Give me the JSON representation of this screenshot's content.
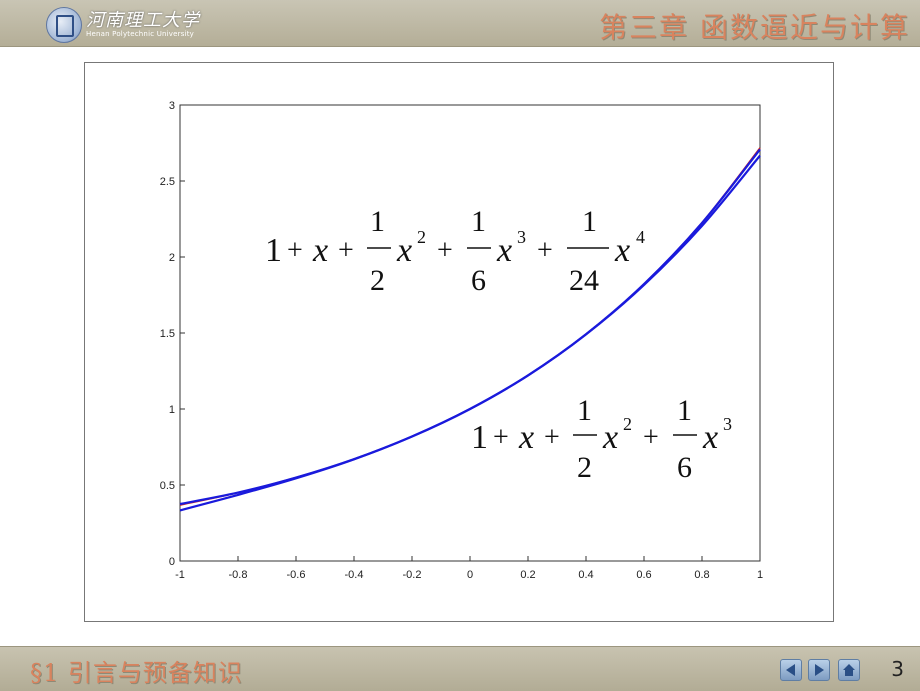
{
  "header": {
    "university_name": "河南理工大学",
    "university_en": "Henan Polytechnic University",
    "chapter_title": "第三章  函数逼近与计算"
  },
  "footer": {
    "section_title": "§1  引言与预备知识",
    "page_number": "3",
    "nav_icons": [
      "prev-arrow-icon",
      "next-arrow-icon",
      "home-icon"
    ]
  },
  "chart_data": {
    "type": "line",
    "xlim": [
      -1,
      1
    ],
    "ylim": [
      0,
      3
    ],
    "x_ticks": [
      "-1",
      "-0.8",
      "-0.6",
      "-0.4",
      "-0.2",
      "0",
      "0.2",
      "0.4",
      "0.6",
      "0.8",
      "1"
    ],
    "y_ticks": [
      "0",
      "0.5",
      "1",
      "1.5",
      "2",
      "2.5",
      "3"
    ],
    "grid": false,
    "x": [
      -1,
      -0.8,
      -0.6,
      -0.4,
      -0.2,
      0,
      0.2,
      0.4,
      0.6,
      0.8,
      1
    ],
    "series": [
      {
        "color": "#cc2222",
        "values": [
          0.368,
          0.449,
          0.549,
          0.67,
          0.819,
          1.0,
          1.221,
          1.492,
          1.822,
          2.226,
          2.718
        ]
      },
      {
        "color": "#1a1adc",
        "values": [
          0.375,
          0.45,
          0.549,
          0.67,
          0.819,
          1.0,
          1.221,
          1.492,
          1.822,
          2.224,
          2.708
        ]
      },
      {
        "color": "#1a1adc",
        "values": [
          0.333,
          0.435,
          0.544,
          0.669,
          0.819,
          1.0,
          1.221,
          1.491,
          1.816,
          2.205,
          2.667
        ]
      }
    ],
    "annotations": [
      {
        "text": "1 + x + (1/2)x² + (1/6)x³ + (1/24)x⁴"
      },
      {
        "text": "1 + x + (1/2)x² + (1/6)x³"
      }
    ]
  }
}
